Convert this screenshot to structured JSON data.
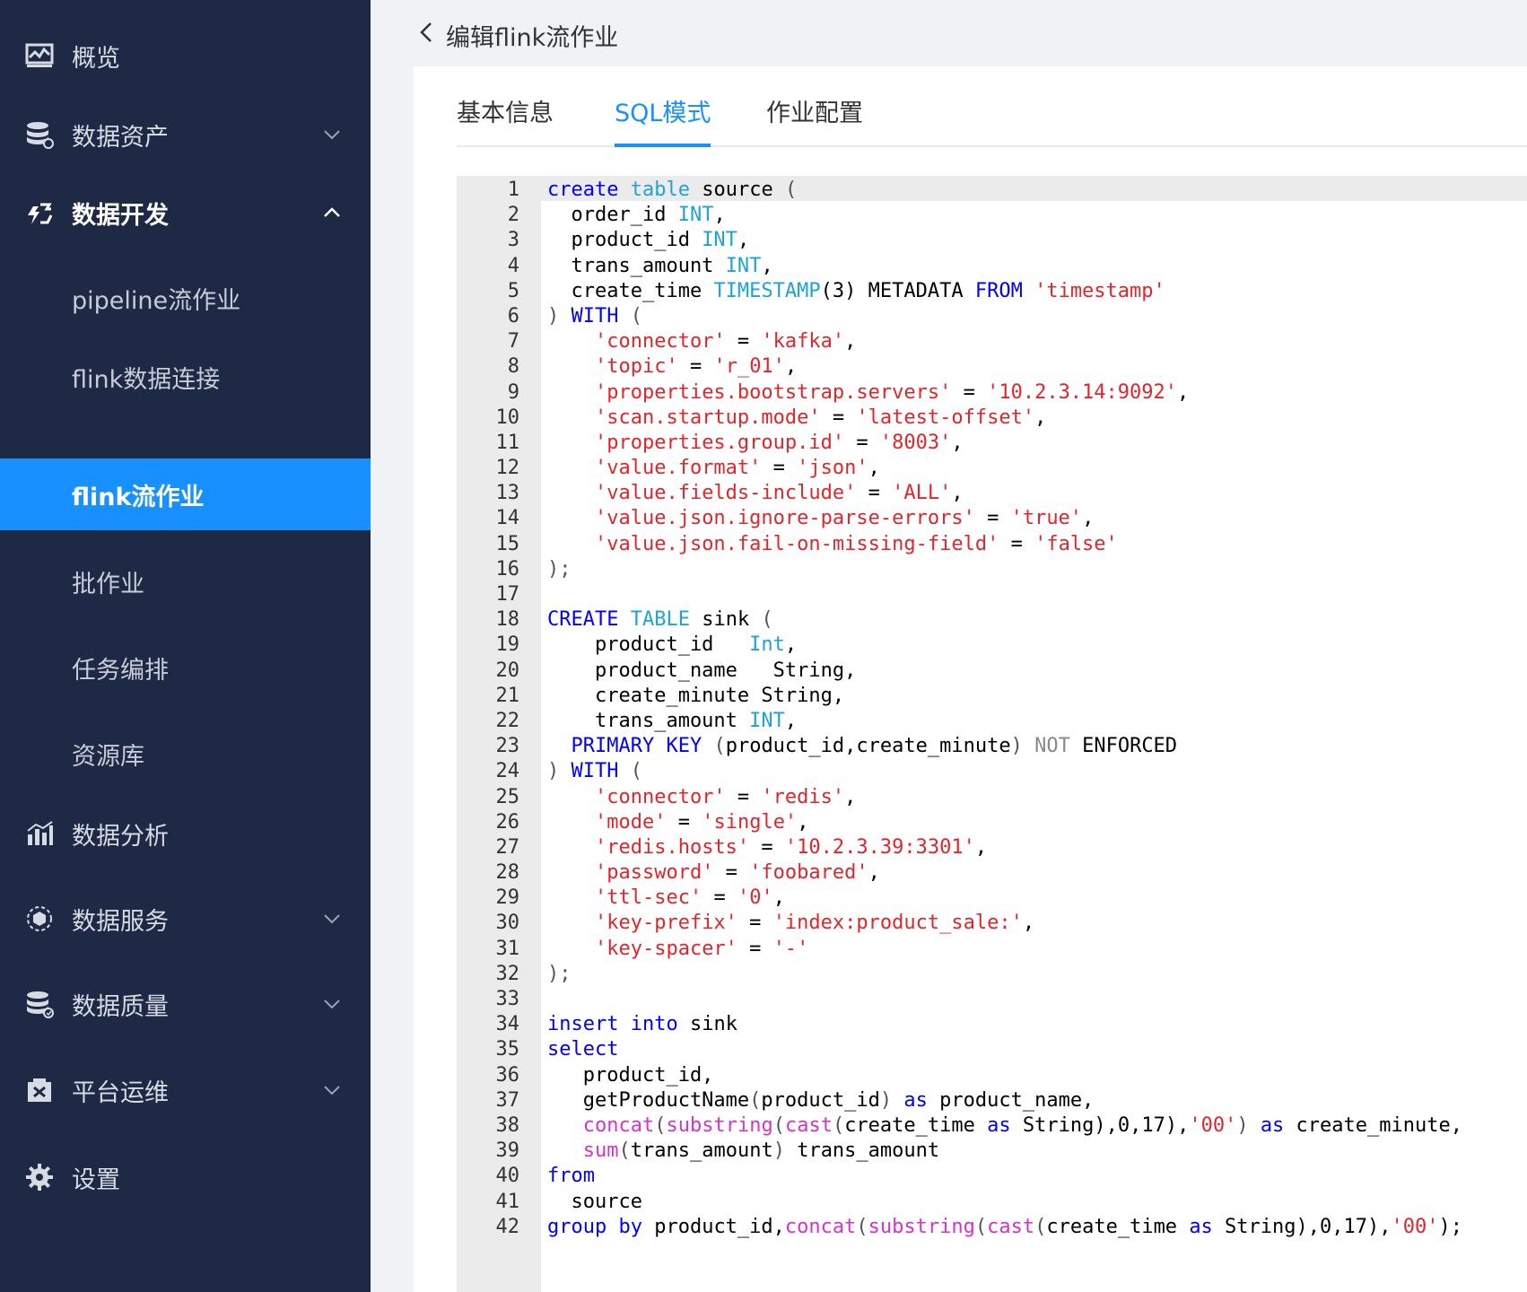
{
  "sidebar": {
    "items": [
      {
        "label": "概览",
        "icon": "dashboard-icon",
        "has_chevron": false,
        "expanded": false
      },
      {
        "label": "数据资产",
        "icon": "database-icon",
        "has_chevron": true,
        "expanded": false
      },
      {
        "label": "数据开发",
        "icon": "data-dev-icon",
        "has_chevron": true,
        "expanded": true,
        "children": [
          {
            "label": "pipeline流作业",
            "active": false
          },
          {
            "label": "flink数据连接",
            "active": false
          },
          {
            "label": "flink流作业",
            "active": true
          },
          {
            "label": "批作业",
            "active": false
          },
          {
            "label": "任务编排",
            "active": false
          },
          {
            "label": "资源库",
            "active": false
          }
        ]
      },
      {
        "label": "数据分析",
        "icon": "bar-chart-icon",
        "has_chevron": false,
        "expanded": false
      },
      {
        "label": "数据服务",
        "icon": "service-icon",
        "has_chevron": true,
        "expanded": false
      },
      {
        "label": "数据质量",
        "icon": "quality-icon",
        "has_chevron": true,
        "expanded": false
      },
      {
        "label": "平台运维",
        "icon": "ops-icon",
        "has_chevron": true,
        "expanded": false
      },
      {
        "label": "设置",
        "icon": "gear-icon",
        "has_chevron": false,
        "expanded": false
      }
    ]
  },
  "header": {
    "title": "编辑flink流作业"
  },
  "tabs": [
    {
      "label": "基本信息",
      "active": false
    },
    {
      "label": "SQL模式",
      "active": true
    },
    {
      "label": "作业配置",
      "active": false
    }
  ],
  "colors": {
    "sidebar_bg": "#1e2a45",
    "accent": "#1890ff",
    "keyword": "#0000ff",
    "type": "#1fa3d6",
    "string": "#e0262b",
    "function": "#d633c8"
  },
  "editor": {
    "lines": [
      [
        [
          "keyword",
          "create"
        ],
        [
          "ident",
          " "
        ],
        [
          "type",
          "table"
        ],
        [
          "ident",
          " source "
        ],
        [
          "punct",
          "("
        ]
      ],
      [
        [
          "ident",
          "  order_id "
        ],
        [
          "type",
          "INT"
        ],
        [
          "ident",
          ","
        ]
      ],
      [
        [
          "ident",
          "  product_id "
        ],
        [
          "type",
          "INT"
        ],
        [
          "ident",
          ","
        ]
      ],
      [
        [
          "ident",
          "  trans_amount "
        ],
        [
          "type",
          "INT"
        ],
        [
          "ident",
          ","
        ]
      ],
      [
        [
          "ident",
          "  create_time "
        ],
        [
          "type",
          "TIMESTAMP"
        ],
        [
          "ident",
          "(3) METADATA "
        ],
        [
          "keyword",
          "FROM"
        ],
        [
          "ident",
          " "
        ],
        [
          "string",
          "'timestamp'"
        ]
      ],
      [
        [
          "punct",
          ")"
        ],
        [
          "ident",
          " "
        ],
        [
          "keyword",
          "WITH"
        ],
        [
          "ident",
          " "
        ],
        [
          "punct",
          "("
        ]
      ],
      [
        [
          "ident",
          "    "
        ],
        [
          "string",
          "'connector'"
        ],
        [
          "ident",
          " = "
        ],
        [
          "string",
          "'kafka'"
        ],
        [
          "ident",
          ","
        ]
      ],
      [
        [
          "ident",
          "    "
        ],
        [
          "string",
          "'topic'"
        ],
        [
          "ident",
          " = "
        ],
        [
          "string",
          "'r_01'"
        ],
        [
          "ident",
          ","
        ]
      ],
      [
        [
          "ident",
          "    "
        ],
        [
          "string",
          "'properties.bootstrap.servers'"
        ],
        [
          "ident",
          " = "
        ],
        [
          "string",
          "'10.2.3.14:9092'"
        ],
        [
          "ident",
          ","
        ]
      ],
      [
        [
          "ident",
          "    "
        ],
        [
          "string",
          "'scan.startup.mode'"
        ],
        [
          "ident",
          " = "
        ],
        [
          "string",
          "'latest-offset'"
        ],
        [
          "ident",
          ","
        ]
      ],
      [
        [
          "ident",
          "    "
        ],
        [
          "string",
          "'properties.group.id'"
        ],
        [
          "ident",
          " = "
        ],
        [
          "string",
          "'8003'"
        ],
        [
          "ident",
          ","
        ]
      ],
      [
        [
          "ident",
          "    "
        ],
        [
          "string",
          "'value.format'"
        ],
        [
          "ident",
          " = "
        ],
        [
          "string",
          "'json'"
        ],
        [
          "ident",
          ","
        ]
      ],
      [
        [
          "ident",
          "    "
        ],
        [
          "string",
          "'value.fields-include'"
        ],
        [
          "ident",
          " = "
        ],
        [
          "string",
          "'ALL'"
        ],
        [
          "ident",
          ","
        ]
      ],
      [
        [
          "ident",
          "    "
        ],
        [
          "string",
          "'value.json.ignore-parse-errors'"
        ],
        [
          "ident",
          " = "
        ],
        [
          "string",
          "'true'"
        ],
        [
          "ident",
          ","
        ]
      ],
      [
        [
          "ident",
          "    "
        ],
        [
          "string",
          "'value.json.fail-on-missing-field'"
        ],
        [
          "ident",
          " = "
        ],
        [
          "string",
          "'false'"
        ]
      ],
      [
        [
          "punct",
          ");"
        ]
      ],
      [],
      [
        [
          "keyword",
          "CREATE"
        ],
        [
          "ident",
          " "
        ],
        [
          "type",
          "TABLE"
        ],
        [
          "ident",
          " sink "
        ],
        [
          "punct",
          "("
        ]
      ],
      [
        [
          "ident",
          "    product_id   "
        ],
        [
          "type",
          "Int"
        ],
        [
          "ident",
          ","
        ]
      ],
      [
        [
          "ident",
          "    product_name   String,"
        ]
      ],
      [
        [
          "ident",
          "    create_minute String,"
        ]
      ],
      [
        [
          "ident",
          "    trans_amount "
        ],
        [
          "type",
          "INT"
        ],
        [
          "ident",
          ","
        ]
      ],
      [
        [
          "ident",
          "  "
        ],
        [
          "keyword",
          "PRIMARY KEY"
        ],
        [
          "ident",
          " "
        ],
        [
          "punct",
          "("
        ],
        [
          "ident",
          "product_id,create_minute"
        ],
        [
          "punct",
          ")"
        ],
        [
          "ident",
          " "
        ],
        [
          "muted",
          "NOT"
        ],
        [
          "ident",
          " ENFORCED"
        ]
      ],
      [
        [
          "punct",
          ")"
        ],
        [
          "ident",
          " "
        ],
        [
          "keyword",
          "WITH"
        ],
        [
          "ident",
          " "
        ],
        [
          "punct",
          "("
        ]
      ],
      [
        [
          "ident",
          "    "
        ],
        [
          "string",
          "'connector'"
        ],
        [
          "ident",
          " = "
        ],
        [
          "string",
          "'redis'"
        ],
        [
          "ident",
          ","
        ]
      ],
      [
        [
          "ident",
          "    "
        ],
        [
          "string",
          "'mode'"
        ],
        [
          "ident",
          " = "
        ],
        [
          "string",
          "'single'"
        ],
        [
          "ident",
          ","
        ]
      ],
      [
        [
          "ident",
          "    "
        ],
        [
          "string",
          "'redis.hosts'"
        ],
        [
          "ident",
          " = "
        ],
        [
          "string",
          "'10.2.3.39:3301'"
        ],
        [
          "ident",
          ","
        ]
      ],
      [
        [
          "ident",
          "    "
        ],
        [
          "string",
          "'password'"
        ],
        [
          "ident",
          " = "
        ],
        [
          "string",
          "'foobared'"
        ],
        [
          "ident",
          ","
        ]
      ],
      [
        [
          "ident",
          "    "
        ],
        [
          "string",
          "'ttl-sec'"
        ],
        [
          "ident",
          " = "
        ],
        [
          "string",
          "'0'"
        ],
        [
          "ident",
          ","
        ]
      ],
      [
        [
          "ident",
          "    "
        ],
        [
          "string",
          "'key-prefix'"
        ],
        [
          "ident",
          " = "
        ],
        [
          "string",
          "'index:product_sale:'"
        ],
        [
          "ident",
          ","
        ]
      ],
      [
        [
          "ident",
          "    "
        ],
        [
          "string",
          "'key-spacer'"
        ],
        [
          "ident",
          " = "
        ],
        [
          "string",
          "'-'"
        ]
      ],
      [
        [
          "punct",
          ");"
        ]
      ],
      [],
      [
        [
          "keyword",
          "insert"
        ],
        [
          "ident",
          " "
        ],
        [
          "keyword",
          "into"
        ],
        [
          "ident",
          " sink"
        ]
      ],
      [
        [
          "keyword",
          "select"
        ]
      ],
      [
        [
          "ident",
          "   product_id,"
        ]
      ],
      [
        [
          "ident",
          "   getProductName"
        ],
        [
          "punct",
          "("
        ],
        [
          "ident",
          "product_id"
        ],
        [
          "punct",
          ")"
        ],
        [
          "ident",
          " "
        ],
        [
          "keyword",
          "as"
        ],
        [
          "ident",
          " product_name,"
        ]
      ],
      [
        [
          "ident",
          "   "
        ],
        [
          "func",
          "concat"
        ],
        [
          "punct",
          "("
        ],
        [
          "func",
          "substring"
        ],
        [
          "punct",
          "("
        ],
        [
          "func",
          "cast"
        ],
        [
          "punct",
          "("
        ],
        [
          "ident",
          "create_time "
        ],
        [
          "keyword",
          "as"
        ],
        [
          "ident",
          " String),0,17),"
        ],
        [
          "string",
          "'00'"
        ],
        [
          "punct",
          ")"
        ],
        [
          "ident",
          " "
        ],
        [
          "keyword",
          "as"
        ],
        [
          "ident",
          " create_minute,"
        ]
      ],
      [
        [
          "ident",
          "   "
        ],
        [
          "func",
          "sum"
        ],
        [
          "punct",
          "("
        ],
        [
          "ident",
          "trans_amount"
        ],
        [
          "punct",
          ")"
        ],
        [
          "ident",
          " trans_amount"
        ]
      ],
      [
        [
          "keyword",
          "from"
        ]
      ],
      [
        [
          "ident",
          "  source"
        ]
      ],
      [
        [
          "keyword",
          "group by"
        ],
        [
          "ident",
          " product_id,"
        ],
        [
          "func",
          "concat"
        ],
        [
          "punct",
          "("
        ],
        [
          "func",
          "substring"
        ],
        [
          "punct",
          "("
        ],
        [
          "func",
          "cast"
        ],
        [
          "punct",
          "("
        ],
        [
          "ident",
          "create_time "
        ],
        [
          "keyword",
          "as"
        ],
        [
          "ident",
          " String),0,17),"
        ],
        [
          "string",
          "'00'"
        ],
        [
          "ident",
          ");"
        ]
      ]
    ]
  }
}
